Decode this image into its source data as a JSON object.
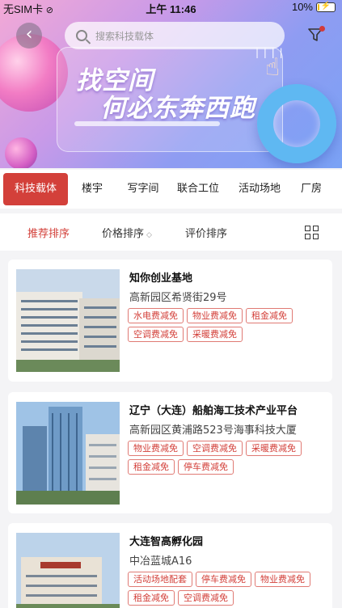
{
  "status_bar": {
    "carrier": "无SIM卡",
    "time": "上午 11:46",
    "battery": "10%",
    "battery_level": 0.1
  },
  "search": {
    "placeholder": "搜索科技载体"
  },
  "banner": {
    "line1": "找空间",
    "line2": "何必东奔西跑"
  },
  "tabs": [
    {
      "label": "科技载体",
      "active": true
    },
    {
      "label": "楼宇"
    },
    {
      "label": "写字间"
    },
    {
      "label": "联合工位"
    },
    {
      "label": "活动场地"
    },
    {
      "label": "厂房"
    }
  ],
  "sort": [
    {
      "label": "推荐排序",
      "active": true
    },
    {
      "label": "价格排序"
    },
    {
      "label": "评价排序"
    }
  ],
  "listings": [
    {
      "name": "知你创业基地",
      "address": "高新园区希贤街29号",
      "tags": [
        "水电费减免",
        "物业费减免",
        "租金减免",
        "空调费减免",
        "采暖费减免"
      ]
    },
    {
      "name": "辽宁（大连）船舶海工技术产业平台",
      "address": "高新园区黄浦路523号海事科技大厦",
      "tags": [
        "物业费减免",
        "空调费减免",
        "采暖费减免",
        "租金减免",
        "停车费减免"
      ]
    },
    {
      "name": "大连智高孵化园",
      "address": "中冶蓝城A16",
      "tags": [
        "活动场地配套",
        "停车费减免",
        "物业费减免",
        "租金减免",
        "空调费减免"
      ]
    }
  ],
  "colors": {
    "accent": "#d3403a"
  }
}
